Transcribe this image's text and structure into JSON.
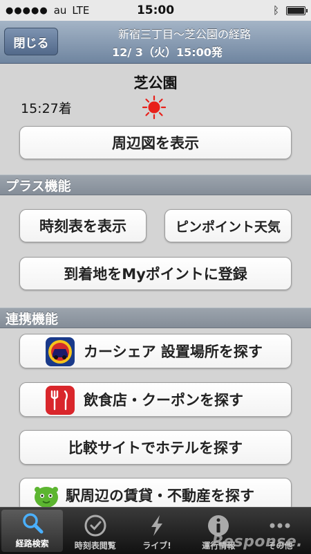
{
  "status_bar": {
    "carrier": "au",
    "network": "LTE",
    "time": "15:00",
    "signal_dots": 5
  },
  "navbar": {
    "close_label": "閉じる",
    "title": "新宿三丁目〜芝公園の経路",
    "subtitle": "12/ 3（火）15:00発"
  },
  "destination": {
    "name": "芝公園",
    "arrival": "15:27着",
    "weather_icon": "sun-icon",
    "weather_color": "#e8201a"
  },
  "buttons": {
    "show_map": "周辺図を表示"
  },
  "plus_section": {
    "header": "プラス機能",
    "timetable": "時刻表を表示",
    "pinpoint_weather": "ピンポイント天気",
    "register_my_point": "到着地をMyポイントに登録"
  },
  "link_section": {
    "header": "連携機能",
    "items": [
      {
        "label": "カーシェア  設置場所を探す",
        "icon": "car-share-icon"
      },
      {
        "label": "飲食店・クーポンを探す",
        "icon": "restaurant-icon"
      },
      {
        "label": "比較サイトでホテルを探す",
        "icon": ""
      },
      {
        "label": "駅周辺の賃貸・不動産を探す",
        "icon": "green-mascot-icon"
      }
    ]
  },
  "tabbar": {
    "tabs": [
      {
        "label": "経路検索",
        "icon": "search-icon",
        "active": true
      },
      {
        "label": "時刻表閲覧",
        "icon": "clock-icon",
        "active": false
      },
      {
        "label": "ライブ!",
        "icon": "lightning-icon",
        "active": false
      },
      {
        "label": "運行情報",
        "icon": "info-icon",
        "active": false
      },
      {
        "label": "その他",
        "icon": "more-icon",
        "active": false
      }
    ]
  },
  "watermark": "Response."
}
